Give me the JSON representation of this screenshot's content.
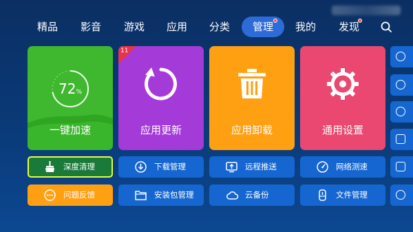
{
  "nav": {
    "items": [
      {
        "label": "精品"
      },
      {
        "label": "影音"
      },
      {
        "label": "游戏"
      },
      {
        "label": "应用"
      },
      {
        "label": "分类"
      },
      {
        "label": "管理",
        "active": true,
        "dot": true
      },
      {
        "label": "我的"
      },
      {
        "label": "发现",
        "dot": true
      }
    ],
    "search_icon": "search-icon"
  },
  "tiles": {
    "speedup": {
      "label": "一键加速",
      "percent": "72",
      "percent_unit": "%",
      "progress": 0.72,
      "color": "#3fb82f"
    },
    "app_update": {
      "label": "应用更新",
      "badge": "11",
      "color": "#a43bd8",
      "icon": "refresh-icon"
    },
    "uninstall": {
      "label": "应用卸载",
      "color": "#ff9f12",
      "icon": "trash-icon"
    },
    "settings": {
      "label": "通用设置",
      "color": "#ea4870",
      "icon": "settings-icon"
    }
  },
  "buttons": {
    "deep_clean": {
      "label": "深度清理",
      "icon": "broom-icon"
    },
    "download_manage": {
      "label": "下载管理",
      "icon": "download-icon"
    },
    "remote_push": {
      "label": "远程推送",
      "icon": "remote-push-icon"
    },
    "speed_test": {
      "label": "网络测速",
      "icon": "speedometer-icon"
    },
    "feedback": {
      "label": "问题反馈",
      "icon": "chat-icon"
    },
    "package_manage": {
      "label": "安装包管理",
      "icon": "folder-icon"
    },
    "cloud_backup": {
      "label": "云备份",
      "icon": "cloud-icon"
    },
    "file_manage": {
      "label": "文件管理",
      "icon": "usb-icon"
    }
  },
  "colors": {
    "active_nav": "#2d6bd6",
    "button": "#1566d1",
    "feedback_button": "#ff9f12",
    "focus_border": "#e8ff3a"
  }
}
